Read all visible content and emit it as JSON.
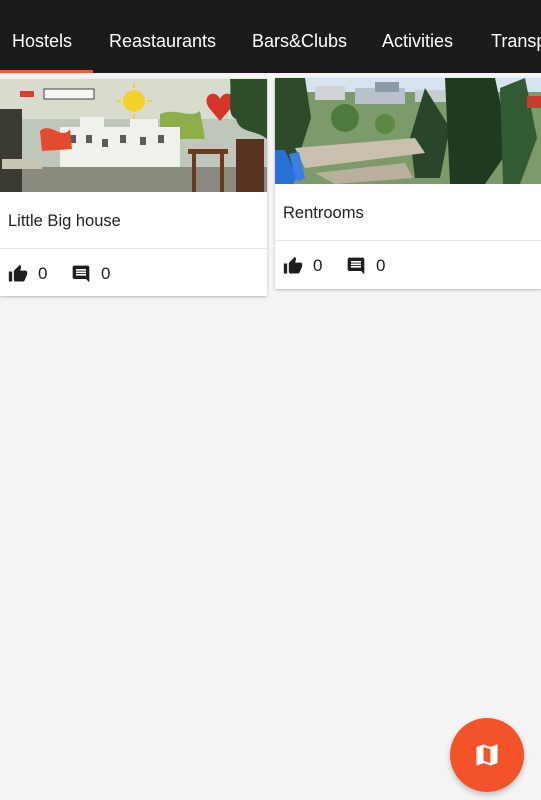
{
  "colors": {
    "tabbar_bg": "#1b1b1b",
    "accent": "#ff5a2e",
    "fab": "#f4532a",
    "page_bg": "#f4f4f4",
    "text": "#212121"
  },
  "tabs": [
    {
      "label": "Hostels",
      "selected": true
    },
    {
      "label": "Reastaurants",
      "selected": false
    },
    {
      "label": "Bars&Clubs",
      "selected": false
    },
    {
      "label": "Activities",
      "selected": false
    },
    {
      "label": "Transp",
      "selected": false
    }
  ],
  "cards": [
    {
      "title": "Little Big house",
      "image": "mural-cafe-photo",
      "likes": "0",
      "comments": "0"
    },
    {
      "title": "Rentrooms",
      "image": "city-park-aerial-photo",
      "likes": "0",
      "comments": "0"
    }
  ],
  "icons": {
    "like": "thumb-up-icon",
    "comment": "comment-icon",
    "fab": "map-icon"
  }
}
